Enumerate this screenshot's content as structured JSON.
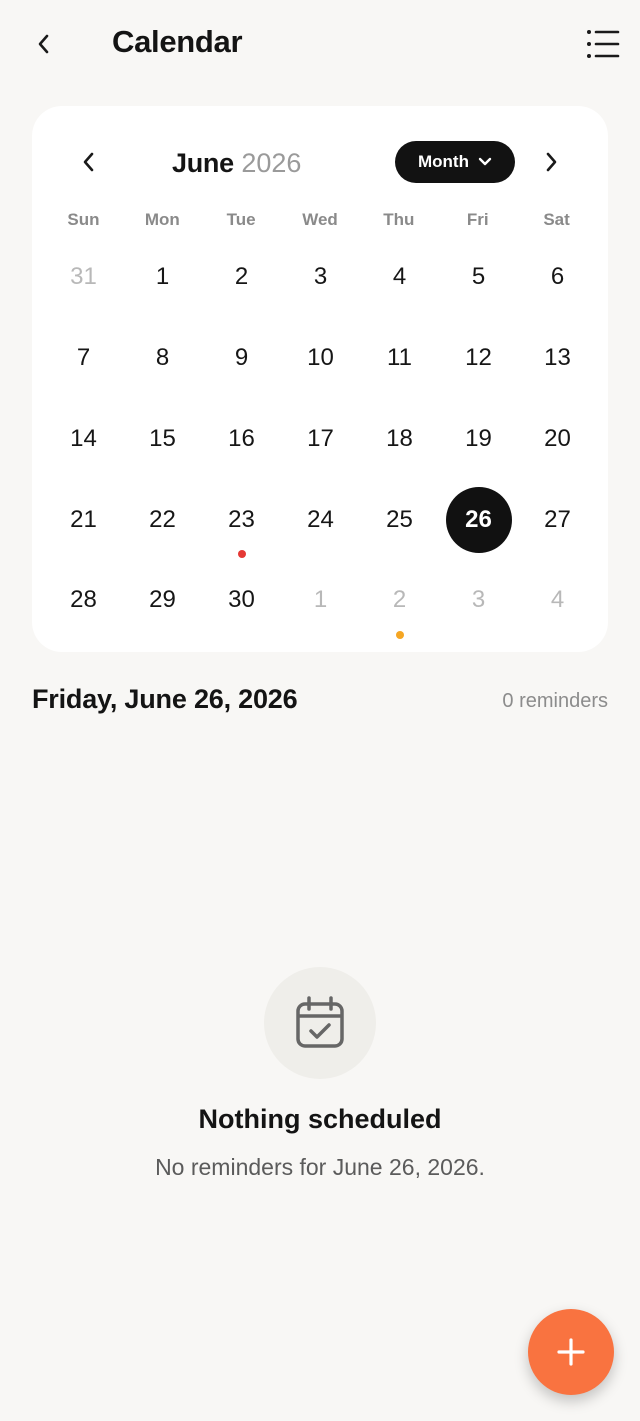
{
  "header": {
    "back_icon": "chevron-left-icon",
    "title": "Calendar",
    "list_icon": "list-icon"
  },
  "calendar": {
    "month": "June",
    "year": "2026",
    "view_label": "Month",
    "weekdays": [
      "Sun",
      "Mon",
      "Tue",
      "Wed",
      "Thu",
      "Fri",
      "Sat"
    ],
    "days": [
      {
        "label": "31",
        "muted": true
      },
      {
        "label": "1"
      },
      {
        "label": "2"
      },
      {
        "label": "3"
      },
      {
        "label": "4"
      },
      {
        "label": "5"
      },
      {
        "label": "6"
      },
      {
        "label": "7"
      },
      {
        "label": "8"
      },
      {
        "label": "9"
      },
      {
        "label": "10"
      },
      {
        "label": "11"
      },
      {
        "label": "12"
      },
      {
        "label": "13"
      },
      {
        "label": "14"
      },
      {
        "label": "15"
      },
      {
        "label": "16"
      },
      {
        "label": "17"
      },
      {
        "label": "18"
      },
      {
        "label": "19"
      },
      {
        "label": "20"
      },
      {
        "label": "21"
      },
      {
        "label": "22"
      },
      {
        "label": "23",
        "dot": "#e53935"
      },
      {
        "label": "24"
      },
      {
        "label": "25"
      },
      {
        "label": "26",
        "selected": true
      },
      {
        "label": "27"
      },
      {
        "label": "28"
      },
      {
        "label": "29"
      },
      {
        "label": "30"
      },
      {
        "label": "1",
        "muted": true
      },
      {
        "label": "2",
        "muted": true,
        "dot": "#f5a623"
      },
      {
        "label": "3",
        "muted": true
      },
      {
        "label": "4",
        "muted": true
      }
    ]
  },
  "selected_day": {
    "heading": "Friday, June 26, 2026",
    "count": "0 reminders"
  },
  "empty_state": {
    "icon": "calendar-check-icon",
    "title": "Nothing scheduled",
    "subtitle": "No reminders for June 26, 2026."
  },
  "fab": {
    "icon": "plus-icon"
  },
  "colors": {
    "accent": "#f97340",
    "selected": "#111111",
    "dot_red": "#e53935",
    "dot_orange": "#f5a623"
  }
}
